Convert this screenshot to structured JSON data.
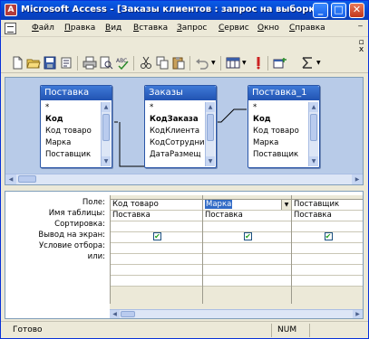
{
  "window": {
    "title": "Microsoft Access - [Заказы клиентов : запрос на выборку]",
    "minimize_label": "_",
    "maximize_label": "□",
    "close_label": "✕",
    "app_icon_label": "A"
  },
  "menubar": {
    "items": [
      "Файл",
      "Правка",
      "Вид",
      "Вставка",
      "Запрос",
      "Сервис",
      "Окно",
      "Справка"
    ],
    "doc_min": "_",
    "doc_restore": "▫",
    "doc_close": "x"
  },
  "toolbar": {
    "icons": [
      "new-icon",
      "open-icon",
      "save-icon",
      "print-icon",
      "print-preview-icon",
      "spelling-icon",
      "cut-icon",
      "copy-icon",
      "paste-icon",
      "undo-icon",
      "query-type-icon",
      "run-icon",
      "show-table-icon",
      "totals-icon"
    ]
  },
  "tables": [
    {
      "name": "Поставка",
      "fields": [
        {
          "label": "*",
          "key": false
        },
        {
          "label": "Код",
          "key": true
        },
        {
          "label": "Код товаро",
          "key": false
        },
        {
          "label": "Марка",
          "key": false
        },
        {
          "label": "Поставщик",
          "key": false
        }
      ]
    },
    {
      "name": "Заказы",
      "fields": [
        {
          "label": "*",
          "key": false
        },
        {
          "label": "КодЗаказа",
          "key": true
        },
        {
          "label": "КодКлиента",
          "key": false
        },
        {
          "label": "КодСотрудни",
          "key": false
        },
        {
          "label": "ДатаРазмещ",
          "key": false
        }
      ]
    },
    {
      "name": "Поставка_1",
      "fields": [
        {
          "label": "*",
          "key": false
        },
        {
          "label": "Код",
          "key": true
        },
        {
          "label": "Код товаро",
          "key": false
        },
        {
          "label": "Марка",
          "key": false
        },
        {
          "label": "Поставщик",
          "key": false
        }
      ]
    }
  ],
  "grid": {
    "row_labels": [
      "Поле:",
      "Имя таблицы:",
      "Сортировка:",
      "Вывод на экран:",
      "Условие отбора:",
      "или:"
    ],
    "columns": [
      {
        "field": "Код товаро",
        "table": "Поставка",
        "sort": "",
        "show": true
      },
      {
        "field": "Марка",
        "table": "Поставка",
        "sort": "",
        "show": true
      },
      {
        "field": "Поставщик",
        "table": "Поставка",
        "sort": "",
        "show": true
      }
    ]
  },
  "statusbar": {
    "text": "Готово",
    "num": "NUM"
  }
}
